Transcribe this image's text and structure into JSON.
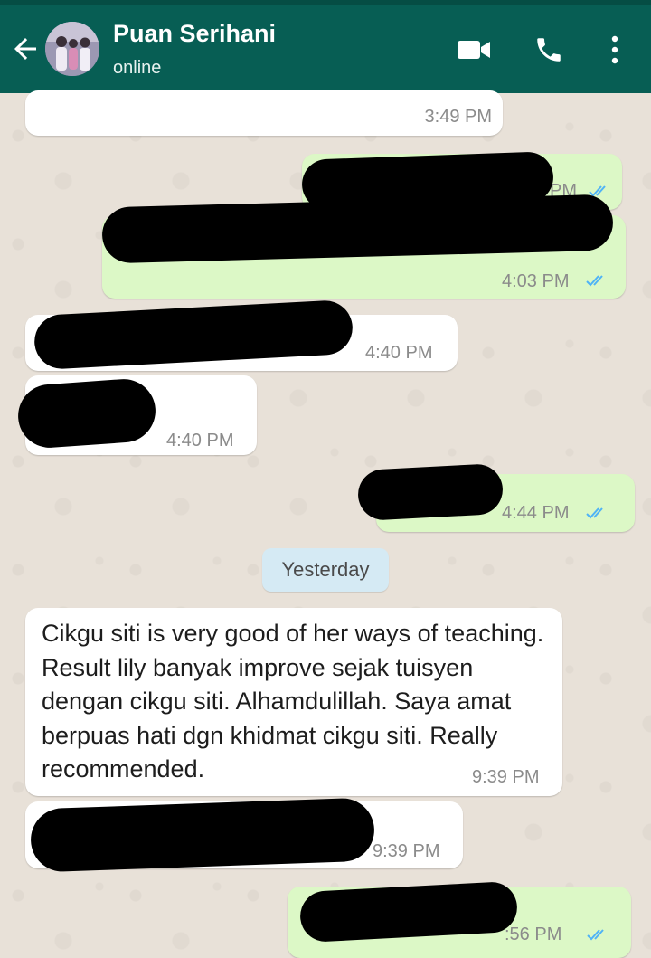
{
  "header": {
    "contact_name": "Puan Serihani",
    "contact_status": "online",
    "colors": {
      "bar": "#075e54",
      "outgoing": "#dcf8c6",
      "incoming": "#ffffff",
      "tick_blue": "#4fb3f6"
    },
    "icons": [
      "arrow-left-icon",
      "avatar",
      "video-camera-icon",
      "phone-icon",
      "more-vertical-icon"
    ]
  },
  "messages": [
    {
      "direction": "in",
      "time": "3:49 PM",
      "redacted": false
    },
    {
      "direction": "out",
      "time": "PM",
      "read": true,
      "redacted": true
    },
    {
      "direction": "out",
      "time": "4:03 PM",
      "read": true,
      "redacted": true
    },
    {
      "direction": "in",
      "time": "4:40 PM",
      "redacted": true
    },
    {
      "direction": "in",
      "time": "4:40 PM",
      "redacted": true
    },
    {
      "direction": "out",
      "time": "4:44 PM",
      "read": true,
      "redacted": true
    },
    {
      "direction": "in",
      "time": "9:39 PM",
      "redacted": false,
      "text": "Cikgu siti is very good of her ways of teaching. Result lily banyak improve sejak tuisyen dengan cikgu siti. Alhamdulillah. Saya amat berpuas hati dgn khidmat cikgu siti. Really recommended."
    },
    {
      "direction": "in",
      "time": "9:39 PM",
      "redacted": true
    },
    {
      "direction": "out",
      "time": ":56 PM",
      "read": true,
      "redacted": true
    }
  ],
  "date_separator": "Yesterday"
}
